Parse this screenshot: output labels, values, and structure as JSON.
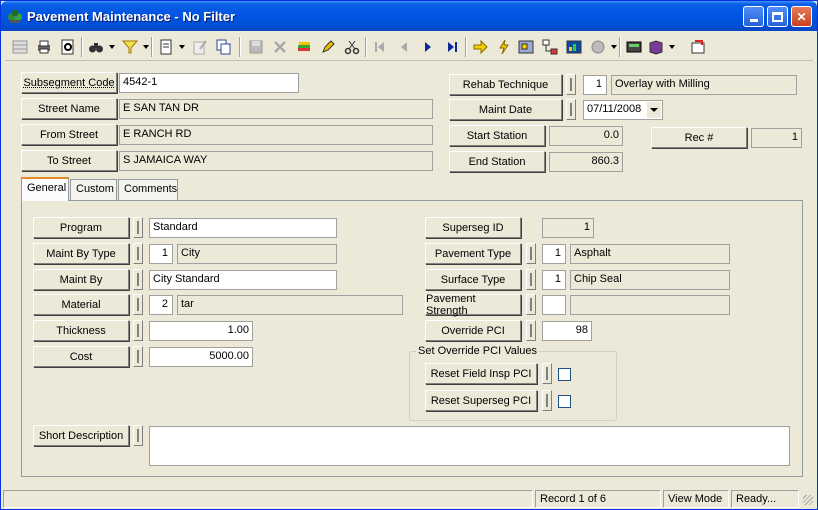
{
  "window": {
    "title": "Pavement Maintenance - No Filter"
  },
  "header": {
    "subsegment_code_label": "Subsegment Code",
    "subsegment_code": "4542-1",
    "street_name_label": "Street Name",
    "street_name": "E SAN TAN DR",
    "from_street_label": "From Street",
    "from_street": "E RANCH RD",
    "to_street_label": "To Street",
    "to_street": "S JAMAICA WAY",
    "rehab_technique_label": "Rehab Technique",
    "rehab_code": "1",
    "rehab_desc": "Overlay with Milling",
    "maint_date_label": "Maint Date",
    "maint_date": "07/11/2008",
    "start_station_label": "Start Station",
    "start_station": "0.0",
    "end_station_label": "End Station",
    "end_station": "860.3",
    "rec_label": "Rec #",
    "rec_value": "1"
  },
  "tabs": [
    {
      "label": "General"
    },
    {
      "label": "Custom"
    },
    {
      "label": "Comments"
    }
  ],
  "general": {
    "program_label": "Program",
    "program": "Standard",
    "maint_by_type_label": "Maint By Type",
    "maint_by_type_code": "1",
    "maint_by_type": "City",
    "maint_by_label": "Maint By",
    "maint_by": "City Standard",
    "material_label": "Material",
    "material_code": "2",
    "material": "tar",
    "thickness_label": "Thickness",
    "thickness": "1.00",
    "cost_label": "Cost",
    "cost": "5000.00",
    "superseg_id_label": "Superseg ID",
    "superseg_id": "1",
    "pavement_type_label": "Pavement Type",
    "pavement_type_code": "1",
    "pavement_type": "Asphalt",
    "surface_type_label": "Surface Type",
    "surface_type_code": "1",
    "surface_type": "Chip Seal",
    "pavement_strength_label": "Pavement Strength",
    "pavement_strength_code": "",
    "pavement_strength": "",
    "override_pci_label": "Override PCI",
    "override_pci": "98",
    "override_group_label": "Set Override PCI Values",
    "reset_field_label": "Reset Field Insp PCI",
    "reset_superseg_label": "Reset Superseg PCI",
    "short_desc_label": "Short Description",
    "short_desc": ""
  },
  "status": {
    "record": "Record 1 of 6",
    "mode": "View Mode",
    "state": "Ready..."
  }
}
